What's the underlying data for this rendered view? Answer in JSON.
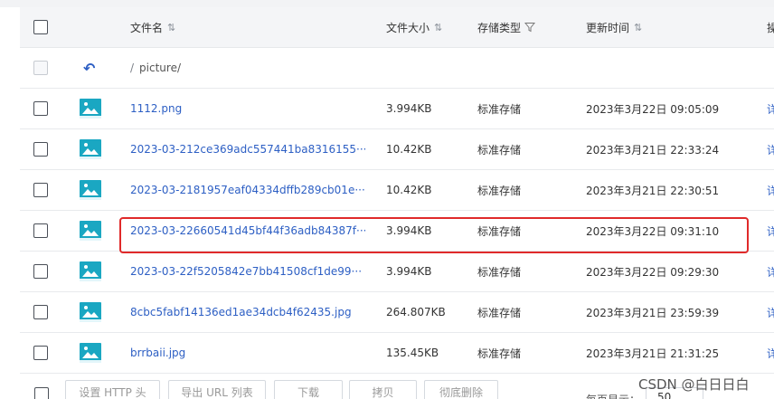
{
  "header": {
    "name_label": "文件名",
    "size_label": "文件大小",
    "type_label": "存储类型",
    "time_label": "更新时间",
    "op_label": "操"
  },
  "parent_row": {
    "path_prefix": "/",
    "path": "picture/"
  },
  "files": [
    {
      "name": "1112.png",
      "size": "3.994KB",
      "storage": "标准存储",
      "time": "2023年3月22日 09:05:09",
      "op": "详",
      "editable": false
    },
    {
      "name": "2023-03-212ce369adc557441ba8316155···",
      "size": "10.42KB",
      "storage": "标准存储",
      "time": "2023年3月21日 22:33:24",
      "op": "详",
      "editable": true
    },
    {
      "name": "2023-03-2181957eaf04334dffb289cb01e···",
      "size": "10.42KB",
      "storage": "标准存储",
      "time": "2023年3月21日 22:30:51",
      "op": "详",
      "editable": true
    },
    {
      "name": "2023-03-22660541d45bf44f36adb84387f···",
      "size": "3.994KB",
      "storage": "标准存储",
      "time": "2023年3月22日 09:31:10",
      "op": "详",
      "editable": false
    },
    {
      "name": "2023-03-22f5205842e7bb41508cf1de99···",
      "size": "3.994KB",
      "storage": "标准存储",
      "time": "2023年3月22日 09:29:30",
      "op": "详",
      "editable": false
    },
    {
      "name": "8cbc5fabf14136ed1ae34dcb4f62435.jpg",
      "size": "264.807KB",
      "storage": "标准存储",
      "time": "2023年3月21日 23:59:39",
      "op": "详",
      "editable": false
    },
    {
      "name": "brrbaii.jpg",
      "size": "135.45KB",
      "storage": "标准存储",
      "time": "2023年3月21日 21:31:25",
      "op": "详",
      "editable": false
    }
  ],
  "bottom": {
    "buttons": [
      "设置 HTTP 头",
      "导出 URL 列表",
      "下载",
      "拷贝",
      "彻底删除"
    ],
    "page_size_label": "每页显示：",
    "page_size_value": "50"
  },
  "watermark": "CSDN @白日日白",
  "colors": {
    "link": "#2d5fc4",
    "highlight": "#e02a2a",
    "header_bg": "#f4f5f7"
  }
}
